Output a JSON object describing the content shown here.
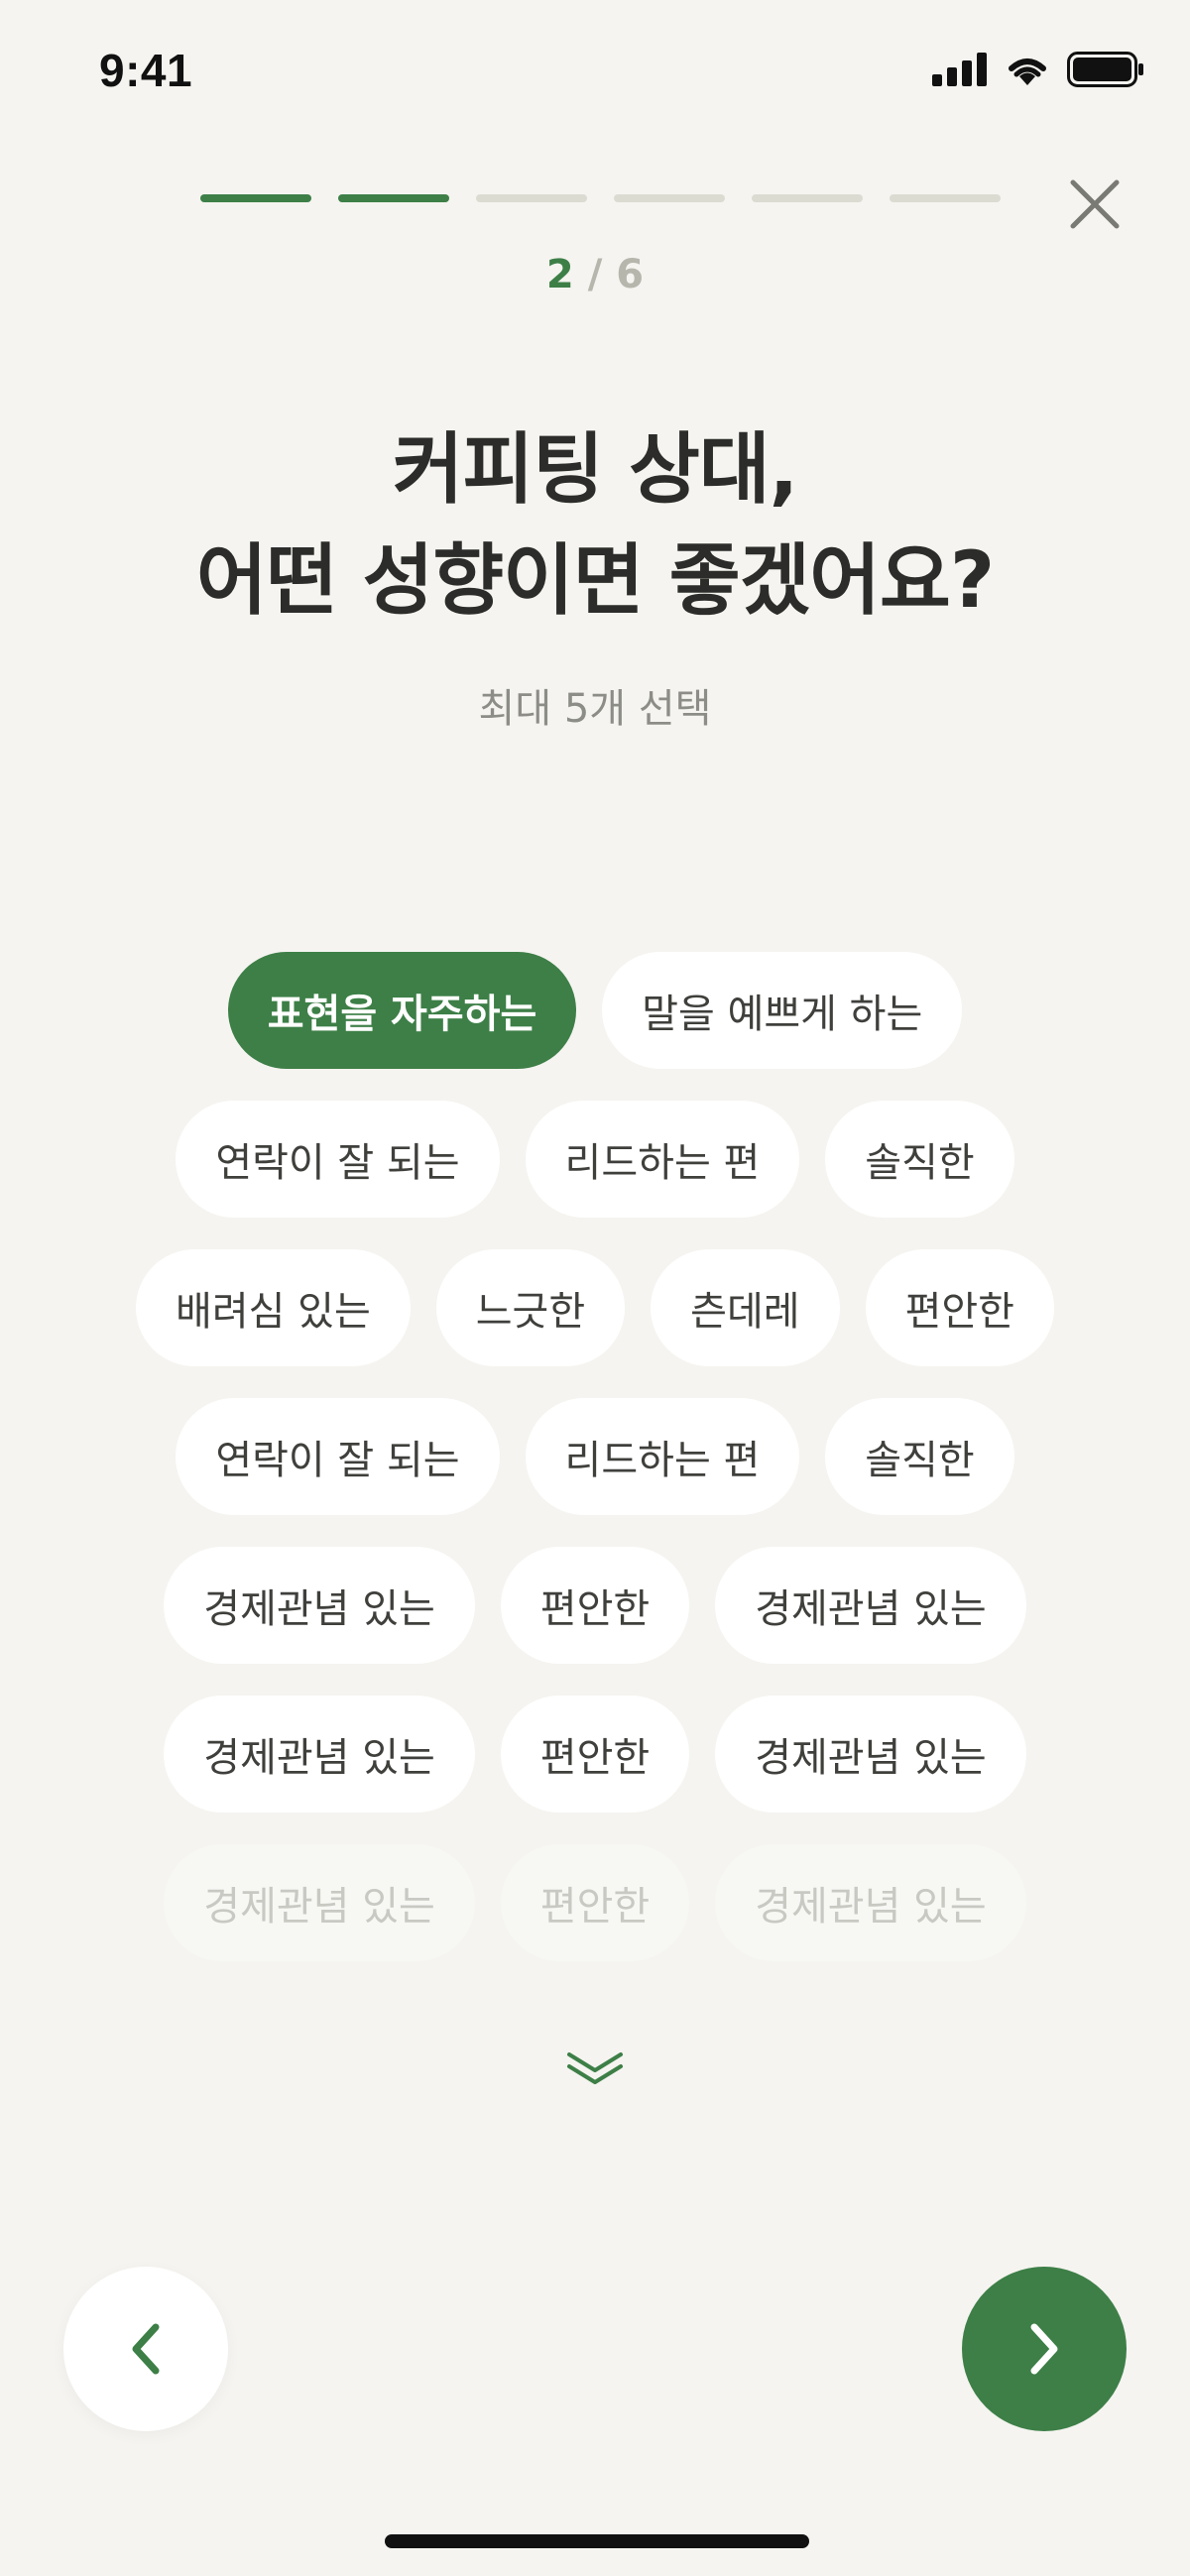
{
  "status_bar": {
    "time": "9:41"
  },
  "progress": {
    "total": 6,
    "completed": 2
  },
  "step": {
    "current": "2",
    "separator": " / ",
    "total": "6"
  },
  "question": {
    "title_line1": "커피팅 상대,",
    "title_line2": "어떤 성향이면 좋겠어요?",
    "subtitle": "최대 5개 선택"
  },
  "chip_rows": [
    [
      {
        "label": "표현을 자주하는",
        "selected": true
      },
      {
        "label": "말을 예쁘게 하는",
        "selected": false
      }
    ],
    [
      {
        "label": "연락이 잘 되는",
        "selected": false
      },
      {
        "label": "리드하는 편",
        "selected": false
      },
      {
        "label": "솔직한",
        "selected": false
      }
    ],
    [
      {
        "label": "배려심 있는",
        "selected": false
      },
      {
        "label": "느긋한",
        "selected": false
      },
      {
        "label": "츤데레",
        "selected": false
      },
      {
        "label": "편안한",
        "selected": false
      }
    ],
    [
      {
        "label": "연락이 잘 되는",
        "selected": false
      },
      {
        "label": "리드하는 편",
        "selected": false
      },
      {
        "label": "솔직한",
        "selected": false
      }
    ],
    [
      {
        "label": "경제관념 있는",
        "selected": false
      },
      {
        "label": "편안한",
        "selected": false
      },
      {
        "label": "경제관념 있는",
        "selected": false
      }
    ],
    [
      {
        "label": "경제관념 있는",
        "selected": false
      },
      {
        "label": "편안한",
        "selected": false
      },
      {
        "label": "경제관념 있는",
        "selected": false
      }
    ],
    [
      {
        "label": "경제관념 있는",
        "selected": false
      },
      {
        "label": "편안한",
        "selected": false
      },
      {
        "label": "경제관념 있는",
        "selected": false
      }
    ]
  ],
  "icons": {
    "close": "close-icon",
    "more": "double-chevron-down-icon",
    "back": "chevron-left-icon",
    "next": "chevron-right-icon"
  },
  "colors": {
    "accent": "#3d7f47",
    "background": "#f5f4f0",
    "progress_inactive": "#dcdbd2",
    "chip_background": "#ffffff"
  }
}
